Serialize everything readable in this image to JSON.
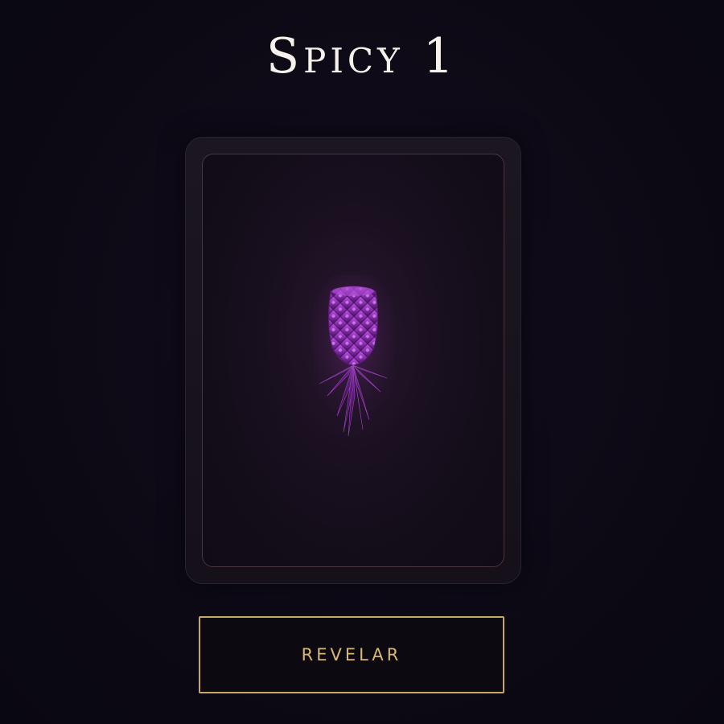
{
  "header": {
    "title": "Spicy 1"
  },
  "card": {
    "image_icon": "upside-down-pineapple-icon",
    "accent_color": "#8a2fb8"
  },
  "actions": {
    "reveal_label": "REVELAR",
    "button_color": "#c9a865"
  }
}
